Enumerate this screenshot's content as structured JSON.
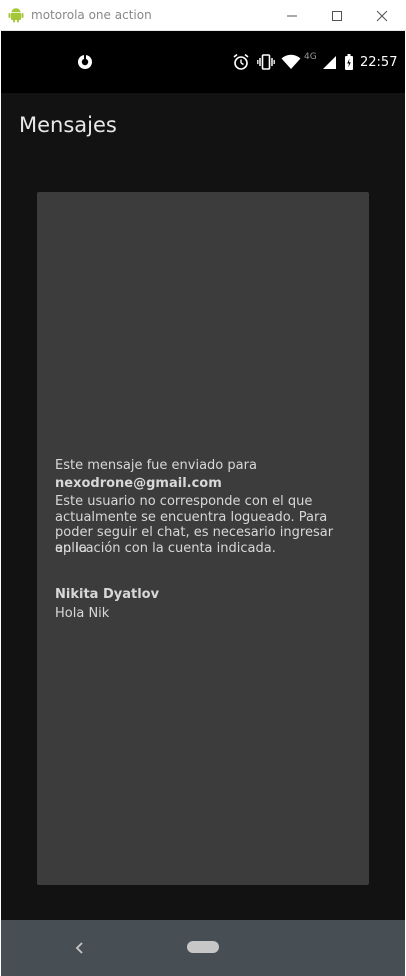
{
  "window": {
    "title": "motorola one action"
  },
  "statusbar": {
    "time": "22:57",
    "network": "4G",
    "icons": [
      "app-notification-icon",
      "alarm-icon",
      "vibrate-icon",
      "wifi-icon",
      "signal-icon",
      "battery-icon"
    ]
  },
  "app": {
    "title": "Mensajes"
  },
  "message": {
    "line1": "Este mensaje fue enviado para",
    "email": "nexodrone@gmail.com",
    "notice_lines": [
      "Este usuario no corresponde con el que",
      "actualmente se encuentra logueado. Para",
      "poder seguir el chat, es necesario ingresar en la",
      "aplicación con la cuenta indicada."
    ],
    "sender": "Nikita Dyatlov",
    "text": "Hola Nik"
  },
  "colors": {
    "background": "#121212",
    "card": "#3c3c3c",
    "navbar": "#474f55",
    "android_green": "#a4c639"
  },
  "navbar": {
    "icons": [
      "back-icon",
      "home-pill-icon"
    ]
  }
}
